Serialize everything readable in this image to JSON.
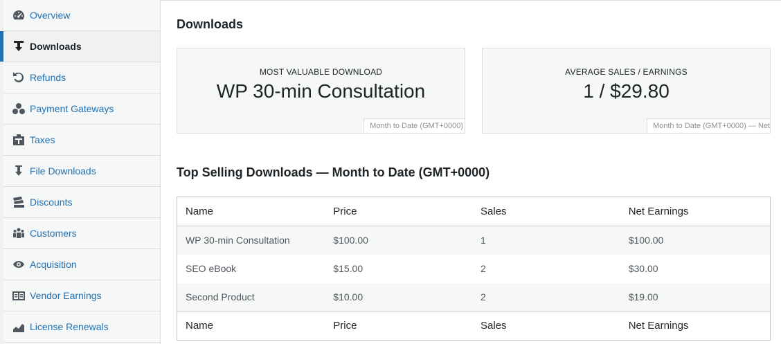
{
  "sidebar": {
    "items": [
      {
        "label": "Overview",
        "icon": "dashboard-icon",
        "active": false
      },
      {
        "label": "Downloads",
        "icon": "download-icon",
        "active": true
      },
      {
        "label": "Refunds",
        "icon": "undo-icon",
        "active": false
      },
      {
        "label": "Payment Gateways",
        "icon": "groups-icon",
        "active": false
      },
      {
        "label": "Taxes",
        "icon": "bank-icon",
        "active": false
      },
      {
        "label": "File Downloads",
        "icon": "download-icon",
        "active": false
      },
      {
        "label": "Discounts",
        "icon": "tickets-icon",
        "active": false
      },
      {
        "label": "Customers",
        "icon": "users-icon",
        "active": false
      },
      {
        "label": "Acquisition",
        "icon": "visibility-icon",
        "active": false
      },
      {
        "label": "Vendor Earnings",
        "icon": "vendor-icon",
        "active": false
      },
      {
        "label": "License Renewals",
        "icon": "chart-area-icon",
        "active": false
      }
    ]
  },
  "main": {
    "title": "Downloads",
    "tiles": [
      {
        "label": "MOST VALUABLE DOWNLOAD",
        "value": "WP 30-min Consultation",
        "footnote": "Month to Date (GMT+0000)"
      },
      {
        "label": "AVERAGE SALES / EARNINGS",
        "value": "1 / $29.80",
        "footnote": "Month to Date (GMT+0000) — Net"
      }
    ],
    "table_title": "Top Selling Downloads — Month to Date (GMT+0000)",
    "table": {
      "columns": [
        "Name",
        "Price",
        "Sales",
        "Net Earnings"
      ],
      "rows": [
        [
          "WP 30-min Consultation",
          "$100.00",
          "1",
          "$100.00"
        ],
        [
          "SEO eBook",
          "$15.00",
          "2",
          "$30.00"
        ],
        [
          "Second Product",
          "$10.00",
          "2",
          "$19.00"
        ]
      ]
    }
  },
  "colors": {
    "accent": "#2271b1",
    "text": "#1d2327",
    "muted": "#8c8f94",
    "border": "#dcdcde"
  }
}
